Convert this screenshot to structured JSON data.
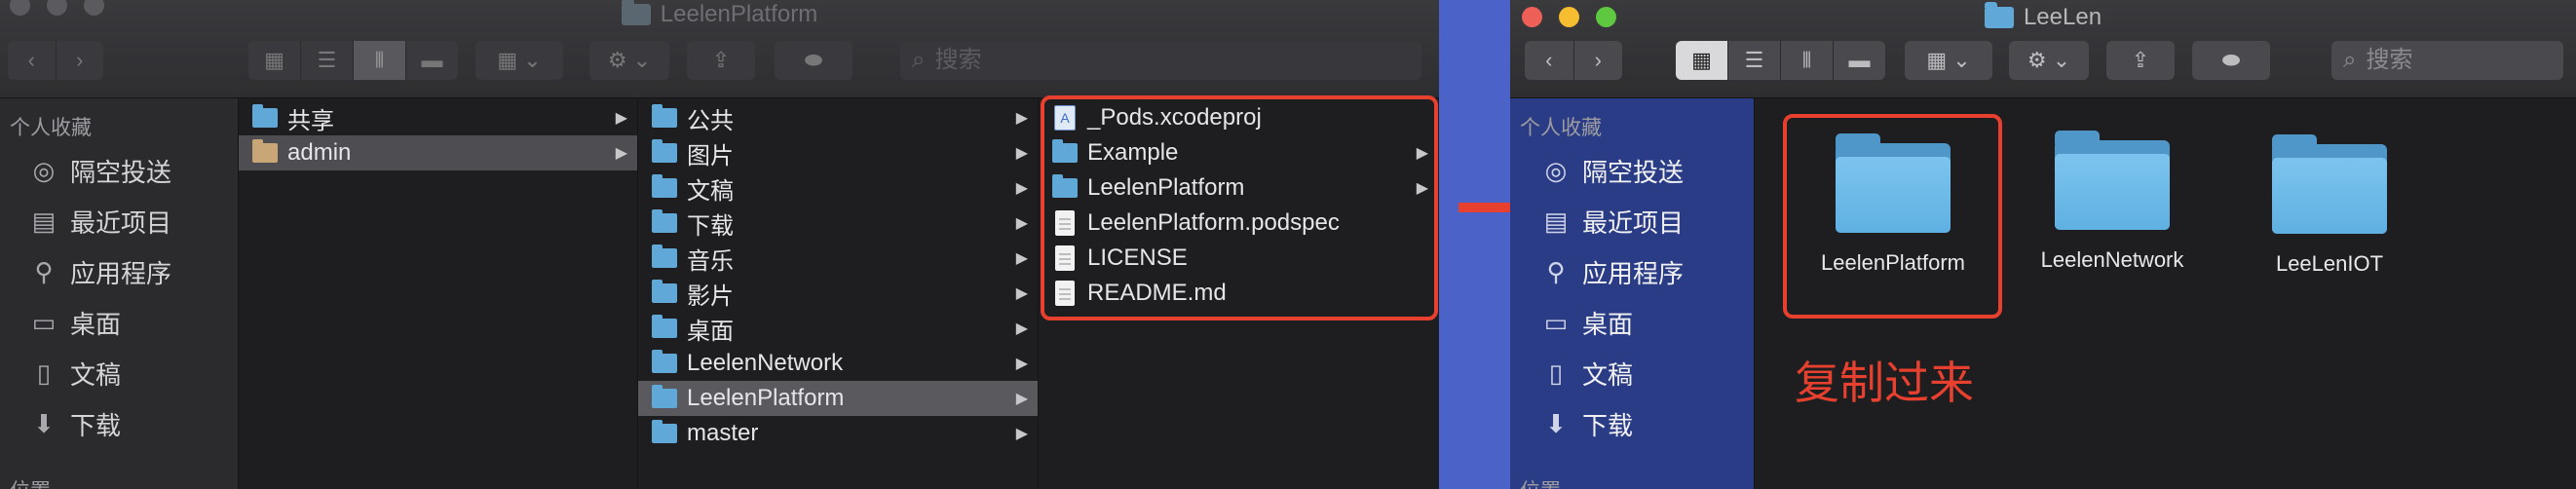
{
  "left_window": {
    "title": "LeelenPlatform",
    "toolbar": {
      "back": "‹",
      "forward": "›",
      "view_icon": "▦",
      "view_list": "☰",
      "view_columns": "⫴",
      "view_gallery": "▬",
      "group": "▦ ⌄",
      "action": "⚙ ⌄",
      "share": "⇪",
      "tag": "⬬"
    },
    "search": {
      "placeholder": "搜索"
    },
    "sidebar": {
      "favorites_header": "个人收藏",
      "items": [
        {
          "label": "隔空投送",
          "icon": "airdrop-icon",
          "glyph": "◎"
        },
        {
          "label": "最近项目",
          "icon": "recents-icon",
          "glyph": "▤"
        },
        {
          "label": "应用程序",
          "icon": "applications-icon",
          "glyph": "⚲"
        },
        {
          "label": "桌面",
          "icon": "desktop-icon",
          "glyph": "▭"
        },
        {
          "label": "文稿",
          "icon": "documents-icon",
          "glyph": "▯"
        },
        {
          "label": "下载",
          "icon": "downloads-icon",
          "glyph": "⬇"
        }
      ],
      "locations_header": "位置"
    },
    "col1": [
      {
        "label": "共享",
        "type": "folder"
      },
      {
        "label": "admin",
        "type": "home"
      }
    ],
    "col2": [
      {
        "label": "公共"
      },
      {
        "label": "图片"
      },
      {
        "label": "文稿"
      },
      {
        "label": "下载"
      },
      {
        "label": "音乐"
      },
      {
        "label": "影片"
      },
      {
        "label": "桌面"
      },
      {
        "label": "LeelenNetwork"
      },
      {
        "label": "LeelenPlatform"
      },
      {
        "label": "master"
      }
    ],
    "col3": [
      {
        "label": "_Pods.xcodeproj",
        "type": "project"
      },
      {
        "label": "Example",
        "type": "folder"
      },
      {
        "label": "LeelenPlatform",
        "type": "folder"
      },
      {
        "label": "LeelenPlatform.podspec",
        "type": "doc"
      },
      {
        "label": "LICENSE",
        "type": "doc"
      },
      {
        "label": "README.md",
        "type": "doc"
      }
    ],
    "chevron": "▶"
  },
  "right_window": {
    "title": "LeeLen",
    "toolbar": {
      "back": "‹",
      "forward": "›",
      "view_icon": "▦",
      "view_list": "☰",
      "view_columns": "⫴",
      "view_gallery": "▬",
      "group": "▦ ⌄",
      "action": "⚙ ⌄",
      "share": "⇪",
      "tag": "⬬"
    },
    "search": {
      "placeholder": "搜索"
    },
    "sidebar": {
      "favorites_header": "个人收藏",
      "items": [
        {
          "label": "隔空投送",
          "icon": "airdrop-icon",
          "glyph": "◎"
        },
        {
          "label": "最近项目",
          "icon": "recents-icon",
          "glyph": "▤"
        },
        {
          "label": "应用程序",
          "icon": "applications-icon",
          "glyph": "⚲"
        },
        {
          "label": "桌面",
          "icon": "desktop-icon",
          "glyph": "▭"
        },
        {
          "label": "文稿",
          "icon": "documents-icon",
          "glyph": "▯"
        },
        {
          "label": "下载",
          "icon": "downloads-icon",
          "glyph": "⬇"
        }
      ],
      "locations_header": "位置"
    },
    "items": [
      {
        "label": "LeelenPlatform"
      },
      {
        "label": "LeelenNetwork"
      },
      {
        "label": "LeeLenIOT"
      }
    ]
  },
  "annotation": {
    "note": "复制过来",
    "color": "#e8402f"
  }
}
